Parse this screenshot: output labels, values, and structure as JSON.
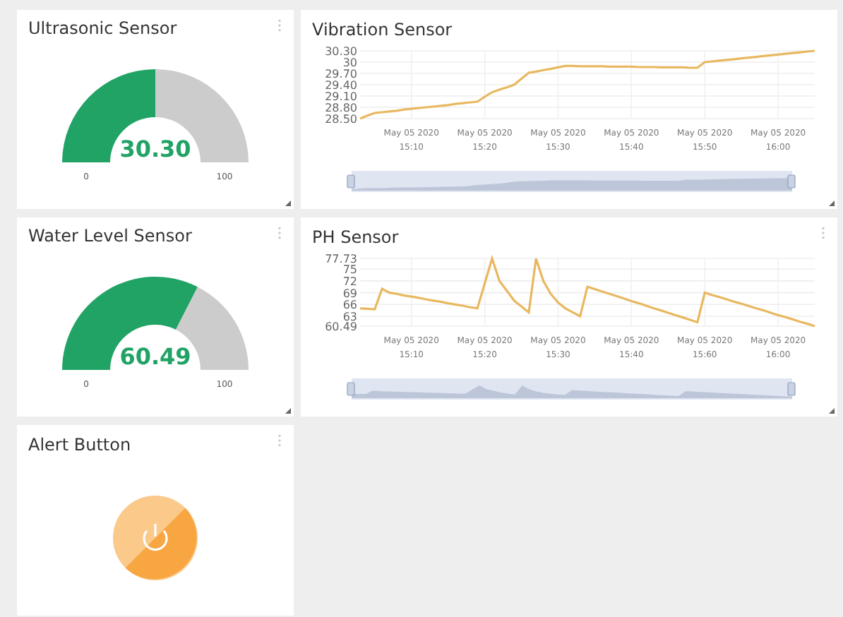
{
  "widgets": [
    {
      "kind": "gauge",
      "title": "Ultrasonic Sensor",
      "menu": true,
      "value": "30.30",
      "min": "0",
      "max": "100"
    },
    {
      "kind": "line_chart",
      "title": "Vibration Sensor",
      "menu": false,
      "level": 1,
      "chart_data": {
        "type": "line",
        "grid": true,
        "ylim": [
          28.5,
          30.3
        ],
        "categories": [
          null,
          null,
          null,
          null,
          null,
          null,
          null,
          "May 05 2020 15:10",
          null,
          null,
          null,
          null,
          null,
          null,
          null,
          null,
          null,
          "May 05 2020 15:20",
          null,
          null,
          null,
          null,
          null,
          null,
          null,
          null,
          null,
          "May 05 2020 15:30",
          null,
          null,
          null,
          null,
          null,
          null,
          null,
          null,
          null,
          "May 05 2020 15:40",
          null,
          null,
          null,
          null,
          null,
          null,
          null,
          null,
          null,
          "May 05 2020 15:50",
          null,
          null,
          null,
          null,
          null,
          null,
          null,
          null,
          null,
          "May 05 2020 16:00",
          null,
          null,
          null,
          null,
          null
        ],
        "series": [
          {
            "color": "#e8b860",
            "values": [
              28.5,
              28.58,
              28.65,
              28.67,
              28.69,
              28.71,
              28.74,
              28.76,
              28.78,
              28.8,
              28.82,
              28.84,
              28.86,
              28.89,
              28.91,
              28.93,
              28.95,
              29.08,
              29.2,
              29.27,
              29.33,
              29.4,
              29.56,
              29.72,
              29.75,
              29.79,
              29.82,
              29.86,
              29.9,
              29.9,
              29.89,
              29.89,
              29.89,
              29.89,
              29.88,
              29.88,
              29.88,
              29.88,
              29.87,
              29.87,
              29.87,
              29.86,
              29.86,
              29.86,
              29.86,
              29.85,
              29.85,
              30.0,
              30.02,
              30.04,
              30.06,
              30.08,
              30.1,
              30.12,
              30.14,
              30.16,
              30.18,
              30.2,
              30.22,
              30.24,
              30.26,
              30.28,
              30.3
            ]
          }
        ],
        "yticks": [
          {
            "value": 30.3,
            "label": "30.30"
          },
          {
            "value": 30,
            "label": "30"
          },
          {
            "value": 29.7,
            "label": "29.70"
          },
          {
            "value": 29.4,
            "label": "29.40"
          },
          {
            "value": 29.1,
            "label": "29.10"
          },
          {
            "value": 28.8,
            "label": "28.80"
          },
          {
            "value": 28.5,
            "label": "28.50"
          }
        ]
      }
    },
    {
      "kind": "gauge",
      "title": "Water Level Sensor",
      "menu": true,
      "value": "60.49",
      "min": "0",
      "max": "100"
    },
    {
      "kind": "line_chart",
      "title": "PH Sensor",
      "menu": true,
      "level": 1,
      "chart_data": {
        "type": "line",
        "grid": true,
        "ylim": [
          60.49,
          77.73
        ],
        "categories": [
          null,
          null,
          null,
          null,
          null,
          null,
          null,
          "May 05 2020 15:10",
          null,
          null,
          null,
          null,
          null,
          null,
          null,
          null,
          null,
          "May 05 2020 15:20",
          null,
          null,
          null,
          null,
          null,
          null,
          null,
          null,
          null,
          "May 05 2020 15:30",
          null,
          null,
          null,
          null,
          null,
          null,
          null,
          null,
          null,
          "May 05 2020 15:40",
          null,
          null,
          null,
          null,
          null,
          null,
          null,
          null,
          null,
          "May 05 2020 15:60",
          null,
          null,
          null,
          null,
          null,
          null,
          null,
          null,
          null,
          "May 05 2020 16:00",
          null,
          null,
          null,
          null,
          null
        ],
        "series": [
          {
            "color": "#e8b860",
            "values": [
              65,
              64.9,
              64.8,
              70,
              69,
              68.7,
              68.3,
              68,
              67.7,
              67.3,
              67,
              66.7,
              66.3,
              66,
              65.7,
              65.3,
              65,
              71.4,
              77.7,
              72,
              69.5,
              67,
              65.5,
              64,
              77.7,
              72,
              68.7,
              66.5,
              65,
              64,
              63,
              70.5,
              69.9,
              69.3,
              68.7,
              68.1,
              67.5,
              66.9,
              66.3,
              65.7,
              65.1,
              64.5,
              63.9,
              63.3,
              62.7,
              62.1,
              61.5,
              69,
              68.4,
              67.9,
              67.3,
              66.7,
              66.2,
              65.6,
              65,
              64.5,
              63.9,
              63.3,
              62.8,
              62.2,
              61.6,
              61.1,
              60.5
            ]
          }
        ],
        "yticks": [
          {
            "value": 77.73,
            "label": "77.73"
          },
          {
            "value": 75,
            "label": "75"
          },
          {
            "value": 72,
            "label": "72"
          },
          {
            "value": 69,
            "label": "69"
          },
          {
            "value": 66,
            "label": "66"
          },
          {
            "value": 63,
            "label": "63"
          },
          {
            "value": 60.49,
            "label": "60.49"
          }
        ]
      }
    },
    {
      "kind": "button",
      "title": "Alert Button",
      "menu": true
    }
  ]
}
